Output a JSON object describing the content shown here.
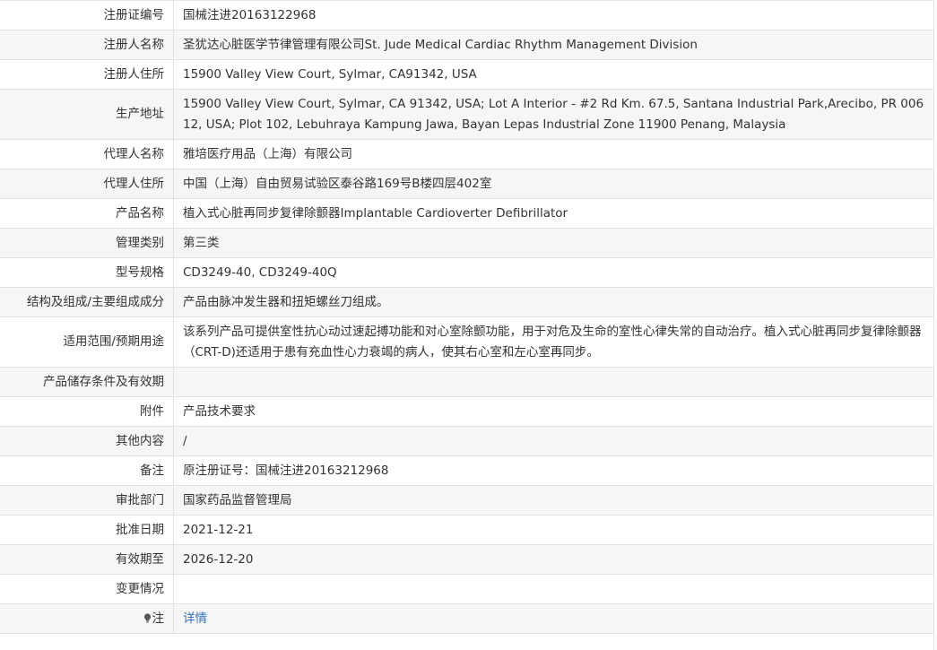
{
  "rows": [
    {
      "label": "注册证编号",
      "value": "国械注进20163122968"
    },
    {
      "label": "注册人名称",
      "value": "圣犹达心脏医学节律管理有限公司St. Jude Medical Cardiac Rhythm Management Division"
    },
    {
      "label": "注册人住所",
      "value": "15900 Valley View Court, Sylmar, CA91342, USA"
    },
    {
      "label": "生产地址",
      "value": "15900 Valley View Court, Sylmar, CA 91342, USA; Lot A Interior - #2 Rd Km. 67.5, Santana Industrial Park,Arecibo, PR 00612, USA; Plot 102, Lebuhraya Kampung Jawa, Bayan Lepas Industrial Zone 11900 Penang, Malaysia"
    },
    {
      "label": "代理人名称",
      "value": "雅培医疗用品（上海）有限公司"
    },
    {
      "label": "代理人住所",
      "value": "中国（上海）自由贸易试验区泰谷路169号B楼四层402室"
    },
    {
      "label": "产品名称",
      "value": "植入式心脏再同步复律除颤器Implantable Cardioverter Defibrillator"
    },
    {
      "label": "管理类别",
      "value": "第三类"
    },
    {
      "label": "型号规格",
      "value": "CD3249-40, CD3249-40Q"
    },
    {
      "label": "结构及组成/主要组成成分",
      "value": "产品由脉冲发生器和扭矩螺丝刀组成。"
    },
    {
      "label": "适用范围/预期用途",
      "value": "该系列产品可提供室性抗心动过速起搏功能和对心室除颤功能，用于对危及生命的室性心律失常的自动治疗。植入式心脏再同步复律除颤器（CRT-D)还适用于患有充血性心力衰竭的病人，使其右心室和左心室再同步。"
    },
    {
      "label": "产品储存条件及有效期",
      "value": ""
    },
    {
      "label": "附件",
      "value": "产品技术要求"
    },
    {
      "label": "其他内容",
      "value": "/"
    },
    {
      "label": "备注",
      "value": "原注册证号：国械注进20163212968"
    },
    {
      "label": "审批部门",
      "value": "国家药品监督管理局"
    },
    {
      "label": "批准日期",
      "value": "2021-12-21"
    },
    {
      "label": "有效期至",
      "value": "2026-12-20"
    },
    {
      "label": "变更情况",
      "value": ""
    }
  ],
  "note": {
    "icon": "lightbulb-icon",
    "label": "注",
    "link_text": "详情"
  },
  "colors": {
    "link": "#2f6fbd",
    "stripe": "#f6f6f6",
    "border": "#e1e1e1"
  }
}
